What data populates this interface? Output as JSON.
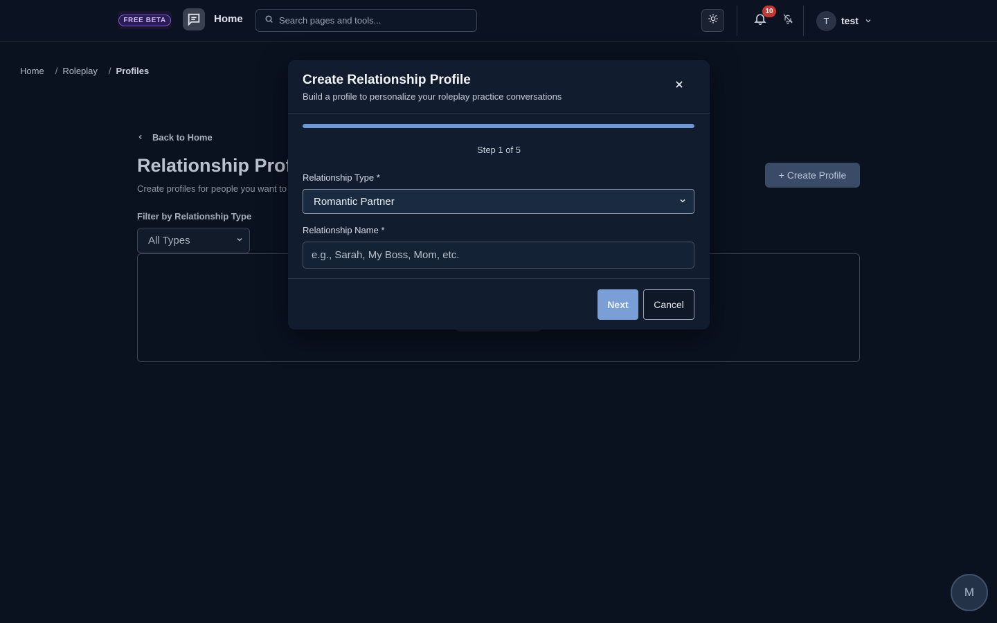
{
  "header": {
    "beta_badge": "FREE BETA",
    "home_label": "Home",
    "search_placeholder": "Search pages and tools...",
    "notification_count": "10",
    "user_initial": "T",
    "user_name": "test"
  },
  "breadcrumb": {
    "items": [
      "Home",
      "Roleplay",
      "Profiles"
    ],
    "separator": "/"
  },
  "page": {
    "back_label": "Back to Home",
    "title": "Relationship Profiles",
    "subtitle": "Create profiles for people you want to practice conversations with",
    "create_button": "+ Create Profile",
    "filter_label": "Filter by Relationship Type",
    "filter_value": "All Types"
  },
  "modal": {
    "title": "Create Relationship Profile",
    "subtitle": "Build a profile to personalize your roleplay practice conversations",
    "progress_percent": 100,
    "step_text": "Step 1 of 5",
    "type_label": "Relationship Type *",
    "type_value": "Romantic Partner",
    "name_label": "Relationship Name *",
    "name_placeholder": "e.g., Sarah, My Boss, Mom, etc.",
    "next_label": "Next",
    "cancel_label": "Cancel"
  },
  "floating_avatar": "M",
  "colors": {
    "background": "#0a1220",
    "modal": "#111c2e",
    "accent": "#7a9fd6",
    "badge": "#c8362f"
  }
}
